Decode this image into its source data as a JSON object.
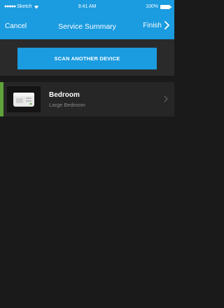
{
  "status_bar": {
    "signal": "●●●●●",
    "carrier": "Sketch",
    "time": "9:41 AM",
    "battery": "100%"
  },
  "nav": {
    "cancel_label": "Cancel",
    "title": "Service Summary",
    "finish_label": "Finish"
  },
  "scan_button_label": "SCAN ANOTHER DEVICE",
  "devices": [
    {
      "name": "Bedroom",
      "subtitle": "Large Bedroom",
      "icon": "smoke-detector-icon"
    }
  ],
  "colors": {
    "brand_blue": "#1b9be0",
    "accent_green": "#5fa33a",
    "background": "#1a1a1a"
  }
}
